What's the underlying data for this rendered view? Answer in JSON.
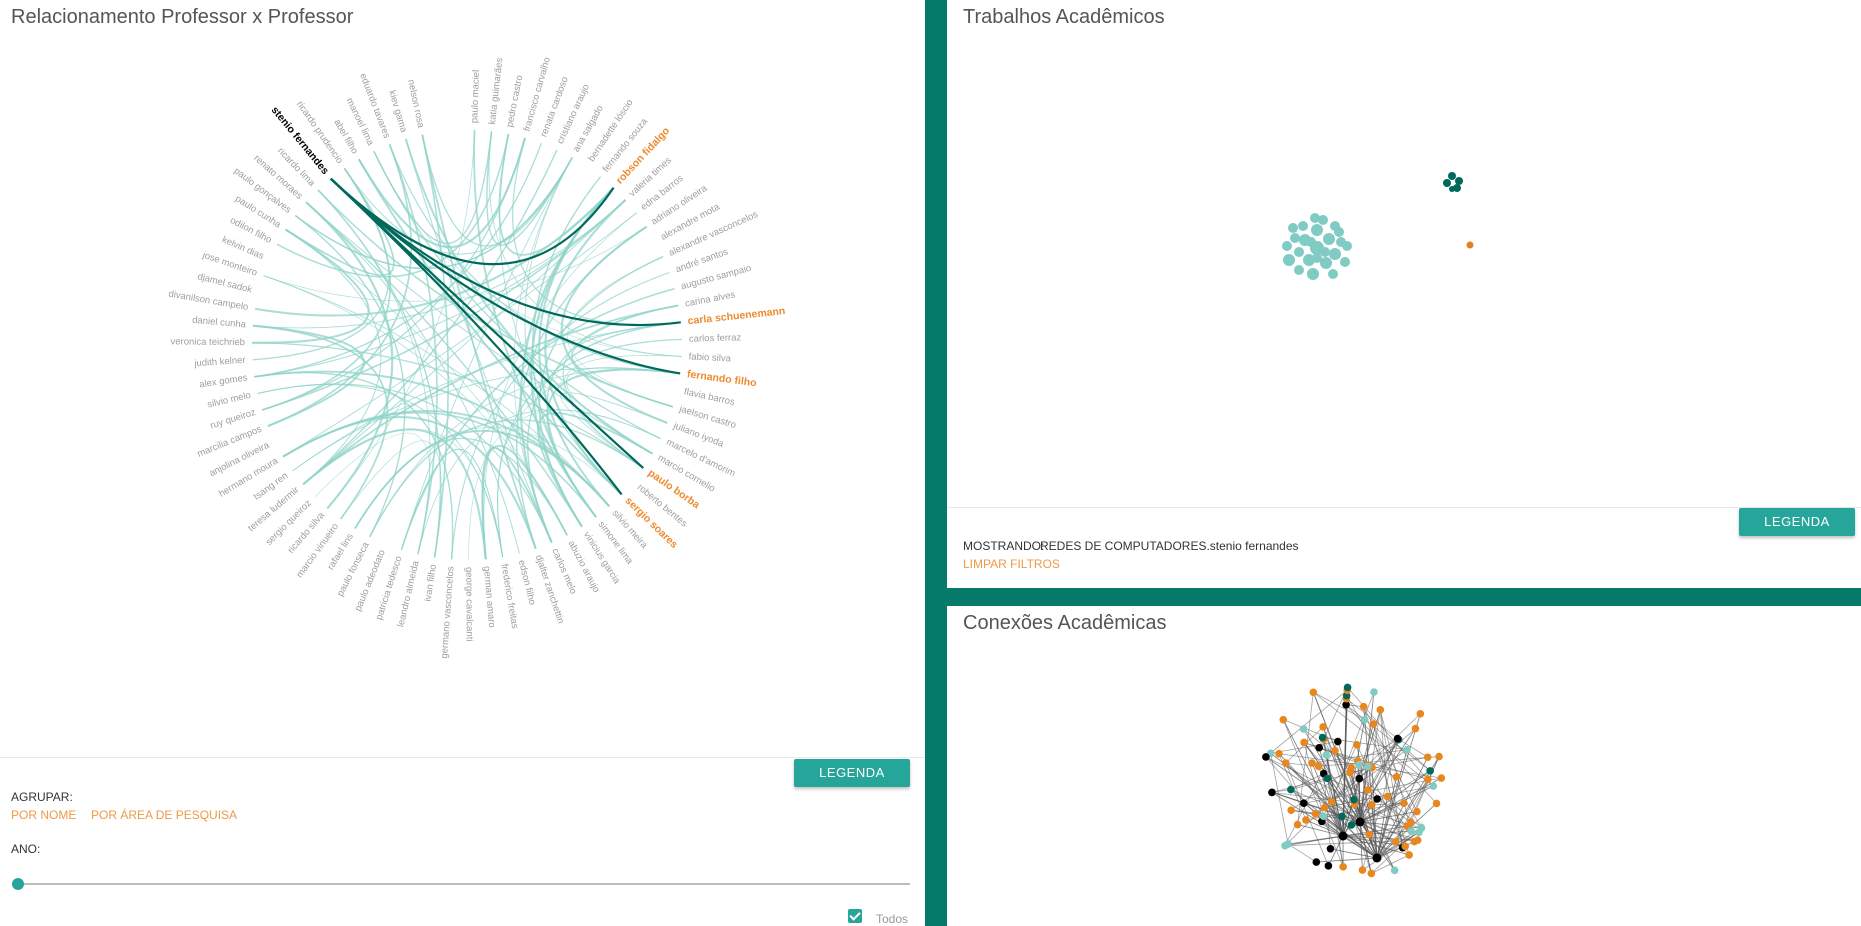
{
  "relacionamento": {
    "title": "Relacionamento Professor x Professor",
    "legend_button": "LEGENDA",
    "agrupar_label": "AGRUPAR:",
    "agrupar_options": [
      "POR NOME",
      "POR ÁREA DE PESQUISA"
    ],
    "ano_label": "ANO:",
    "todos_label": "Todos",
    "todos_checked": true,
    "colors": {
      "link": "#8fd3c8",
      "highlight": "#00695c",
      "label": "#9e9e9e",
      "selected": "#ee8a2f"
    },
    "names": [
      "paulo maciel",
      "katia guimarães",
      "pedro castro",
      "francisco carvalho",
      "renata cardoso",
      "cristiano araujo",
      "ana salgado",
      "bernadette lóscio",
      "fernando souza",
      "robson fidalgo",
      "valeria times",
      "edna barros",
      "adriano oliveira",
      "alexandre mota",
      "alexandre vasconcelos",
      "andré santos",
      "augusto sampaio",
      "carina alves",
      "carla schuenemann",
      "carlos ferraz",
      "fabio silva",
      "fernando filho",
      "flavia barros",
      "jaelson castro",
      "juliano iyoda",
      "marcelo d'amorim",
      "marcio cornelio",
      "paulo borba",
      "roberto bentes",
      "sergio soares",
      "silvio meira",
      "simone lima",
      "vinicius garcia",
      "abuzio araujo",
      "carlos melo",
      "djalter zanchettin",
      "edson filho",
      "frederico freitas",
      "german amaro",
      "george cavalcanti",
      "germano vasconcelos",
      "ivan filho",
      "leandro almeida",
      "patricia tedesco",
      "paulo adeodato",
      "paulo fonseca",
      "rafael lins",
      "marcio vinueiro",
      "ricardo silva",
      "sergio queiroz",
      "teresa ludermir",
      "tsang ren",
      "hermano moura",
      "anjolina oliveira",
      "marcilia campos",
      "ruy queiroz",
      "silvio melo",
      "alex gomes",
      "judith kelner",
      "veronica teichrieb",
      "daniel cunha",
      "divanilson campelo",
      "djamel sadok",
      "jose monteiro",
      "kelvin dias",
      "odilon filho",
      "paulo cunha",
      "paulo gonçalves",
      "renato moraes",
      "ricardo lima",
      "stenio fernandes",
      "ricardo prudencio",
      "abel filho",
      "manoel lima",
      "eduardo tavares",
      "kiev gama",
      "nelson rosa"
    ],
    "selected_name": "stenio fernandes",
    "orange_names": [
      "robson fidalgo",
      "carla schuenemann",
      "fernando filho",
      "paulo borba",
      "sergio soares"
    ]
  },
  "trabalhos": {
    "title": "Trabalhos Acadêmicos",
    "legend_button": "LEGENDA",
    "mostrando_label": "MOSTRANDO:",
    "mostrando_value": "REDES DE COMPUTADORES.stenio fernandes",
    "limpar_label": "LIMPAR FILTROS",
    "colors": {
      "cluster": "#80cbc4",
      "dark": "#00695c",
      "orange": "#e67e22"
    }
  },
  "conexoes": {
    "title": "Conexões Acadêmicas",
    "colors": {
      "orange": "#e8871e",
      "teal": "#80cbc4",
      "dark": "#00695c",
      "black": "#000000",
      "edge": "#555555"
    }
  }
}
